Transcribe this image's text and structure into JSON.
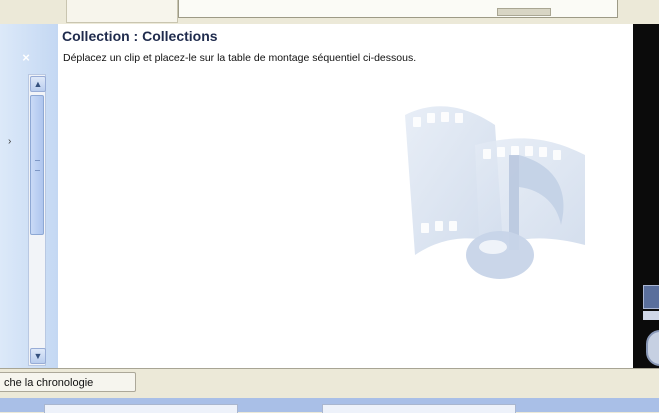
{
  "panel": {
    "title": "Collection : Collections",
    "description": "Déplacez un clip et placez-le sur la table de montage séquentiel ci-dessous."
  },
  "left_pane": {
    "close_glyph": "×"
  },
  "storyboard": {
    "timeline_button_label": "che la chronologie"
  },
  "icons": {
    "close": "close-icon",
    "scroll_up": "chevron-up-icon",
    "scroll_down": "chevron-down-icon",
    "watermark": "film-music-note-icon",
    "side_arrow": "chevron-right-icon"
  },
  "colors": {
    "left_pane": "#c4d8f3",
    "panel_bg": "#ffffff",
    "preview_bg": "#0b0b0b",
    "title_text": "#1f2b4d",
    "chrome": "#ece9d8",
    "bottom_strip": "#a9bfe7"
  }
}
